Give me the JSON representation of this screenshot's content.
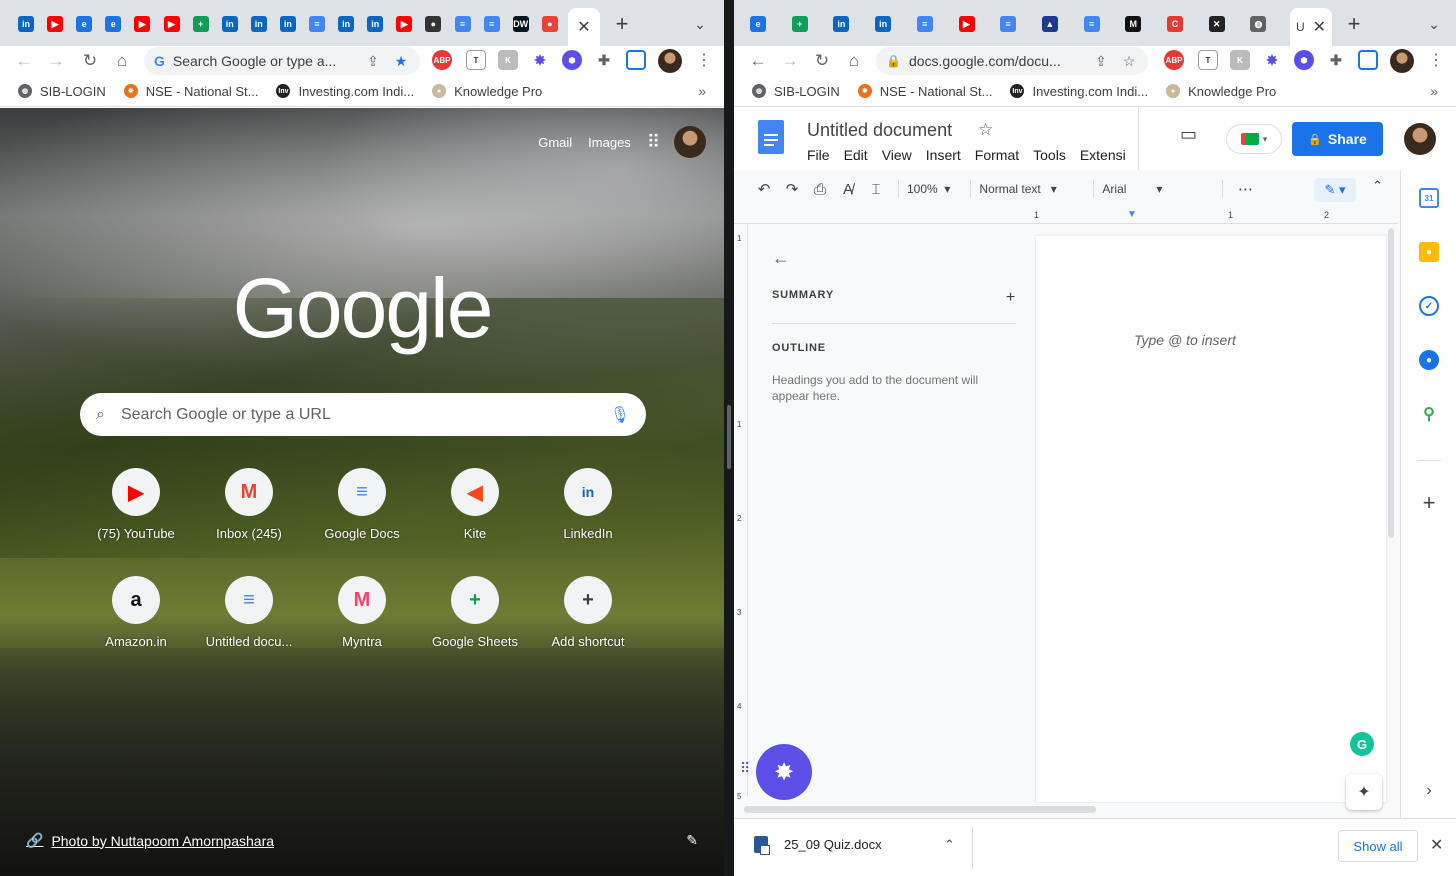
{
  "left": {
    "tabs": [
      {
        "icon": "linkedin-icon",
        "glyph": "in",
        "color": "#0a66c2"
      },
      {
        "icon": "youtube-icon",
        "glyph": "▶",
        "color": "#ff0000"
      },
      {
        "icon": "browser-icon",
        "glyph": "e",
        "color": "#1a73e8"
      },
      {
        "icon": "browser-icon",
        "glyph": "e",
        "color": "#1a73e8"
      },
      {
        "icon": "youtube-icon",
        "glyph": "▶",
        "color": "#ff0000"
      },
      {
        "icon": "youtube-icon",
        "glyph": "▶",
        "color": "#ff0000"
      },
      {
        "icon": "sheets-icon",
        "glyph": "+",
        "color": "#0f9d58"
      },
      {
        "icon": "linkedin-icon",
        "glyph": "in",
        "color": "#0a66c2"
      },
      {
        "icon": "linkedin-icon",
        "glyph": "in",
        "color": "#0a66c2"
      },
      {
        "icon": "linkedin-icon",
        "glyph": "in",
        "color": "#0a66c2"
      },
      {
        "icon": "docs-icon",
        "glyph": "≡",
        "color": "#4285f4"
      },
      {
        "icon": "linkedin-icon",
        "glyph": "in",
        "color": "#0a66c2"
      },
      {
        "icon": "linkedin-icon",
        "glyph": "in",
        "color": "#0a66c2"
      },
      {
        "icon": "youtube-icon",
        "glyph": "▶",
        "color": "#ff0000"
      },
      {
        "icon": "owl-icon",
        "glyph": "●",
        "color": "#333333"
      },
      {
        "icon": "docs-icon",
        "glyph": "≡",
        "color": "#4285f4"
      },
      {
        "icon": "docs-icon",
        "glyph": "≡",
        "color": "#4285f4"
      },
      {
        "icon": "dw-icon",
        "glyph": "DW",
        "color": "#05141f"
      },
      {
        "icon": "chrome-flame-icon",
        "glyph": "●",
        "color": "#ea4335"
      }
    ],
    "omnibox_text": "Search Google or type a...",
    "bookmarks": [
      {
        "label": "SIB-LOGIN",
        "icon": "globe-icon",
        "color": "#5f6368",
        "glyph": "◍"
      },
      {
        "label": "NSE - National St...",
        "icon": "nse-icon",
        "color": "#e8711a",
        "glyph": "✸"
      },
      {
        "label": "Investing.com Indi...",
        "icon": "investing-icon",
        "color": "#222222",
        "glyph": "Inv"
      },
      {
        "label": "Knowledge Pro",
        "icon": "knowledge-icon",
        "color": "#c9b89a",
        "glyph": "●"
      }
    ],
    "ntp": {
      "gmail": "Gmail",
      "images": "Images",
      "logo": "Google",
      "search_placeholder": "Search Google or type a URL",
      "shortcuts": [
        {
          "label": "(75) YouTube",
          "icon": "youtube-icon",
          "color": "#ff0000",
          "glyph": "▶"
        },
        {
          "label": "Inbox (245)",
          "icon": "gmail-icon",
          "color": "#ea4335",
          "glyph": "M"
        },
        {
          "label": "Google Docs",
          "icon": "docs-icon",
          "color": "#4285f4",
          "glyph": "≡"
        },
        {
          "label": "Kite",
          "icon": "kite-icon",
          "color": "#f6461a",
          "glyph": "◀"
        },
        {
          "label": "LinkedIn",
          "icon": "linkedin-icon",
          "color": "#0a66c2",
          "glyph": "in"
        },
        {
          "label": "Amazon.in",
          "icon": "amazon-icon",
          "color": "#111111",
          "glyph": "a"
        },
        {
          "label": "Untitled docu...",
          "icon": "docs-icon",
          "color": "#4285f4",
          "glyph": "≡"
        },
        {
          "label": "Myntra",
          "icon": "myntra-icon",
          "color": "#ff3f6c",
          "glyph": "M"
        },
        {
          "label": "Google Sheets",
          "icon": "sheets-icon",
          "color": "#0f9d58",
          "glyph": "+"
        },
        {
          "label": "Add shortcut",
          "icon": "plus-icon",
          "color": "#3c4043",
          "glyph": "+"
        }
      ],
      "photo_credit": "Photo by Nuttapoom Amornpashara"
    }
  },
  "right": {
    "tabs": [
      {
        "icon": "browser-icon",
        "glyph": "e",
        "color": "#1a73e8"
      },
      {
        "icon": "sheets-icon",
        "glyph": "+",
        "color": "#0f9d58"
      },
      {
        "icon": "linkedin-icon",
        "glyph": "in",
        "color": "#0a66c2"
      },
      {
        "icon": "linkedin-icon",
        "glyph": "in",
        "color": "#0a66c2"
      },
      {
        "icon": "docs-icon",
        "glyph": "≡",
        "color": "#4285f4"
      },
      {
        "icon": "youtube-icon",
        "glyph": "▶",
        "color": "#ff0000"
      },
      {
        "icon": "docs-icon",
        "glyph": "≡",
        "color": "#4285f4"
      },
      {
        "icon": "triangle-icon",
        "glyph": "▲",
        "color": "#1a3b8f"
      },
      {
        "icon": "docs-icon",
        "glyph": "≡",
        "color": "#4285f4"
      },
      {
        "icon": "m-icon",
        "glyph": "M",
        "color": "#111111"
      },
      {
        "icon": "c-icon",
        "glyph": "C",
        "color": "#e53935"
      },
      {
        "icon": "x-icon",
        "glyph": "✕",
        "color": "#222222"
      },
      {
        "icon": "globe-icon",
        "glyph": "◍",
        "color": "#5f6368"
      }
    ],
    "active_tab_glyph": "U",
    "omnibox_text": "docs.google.com/docu...",
    "bookmarks": [
      {
        "label": "SIB-LOGIN",
        "icon": "globe-icon",
        "color": "#5f6368",
        "glyph": "◍"
      },
      {
        "label": "NSE - National St...",
        "icon": "nse-icon",
        "color": "#e8711a",
        "glyph": "✸"
      },
      {
        "label": "Investing.com Indi...",
        "icon": "investing-icon",
        "color": "#222222",
        "glyph": "Inv"
      },
      {
        "label": "Knowledge Pro",
        "icon": "knowledge-icon",
        "color": "#c9b89a",
        "glyph": "●"
      }
    ],
    "docs": {
      "title": "Untitled document",
      "menus": [
        "File",
        "Edit",
        "View",
        "Insert",
        "Format",
        "Tools",
        "Extensi"
      ],
      "share": "Share",
      "zoom": "100%",
      "style": "Normal text",
      "font": "Arial",
      "ruler_numbers": [
        "1",
        "1",
        "2"
      ],
      "vruler_numbers": [
        "1",
        "1",
        "2",
        "3",
        "4",
        "5"
      ],
      "summary": "SUMMARY",
      "outline": "OUTLINE",
      "outline_hint": "Headings you add to the document will appear here.",
      "placeholder": "Type @ to insert",
      "grammarly": "G",
      "download_file": "25_09 Quiz.docx",
      "show_all": "Show all",
      "calendar_day": "31"
    }
  },
  "colors": {
    "accent": "#1a73e8",
    "fab": "#5b4fe8"
  }
}
